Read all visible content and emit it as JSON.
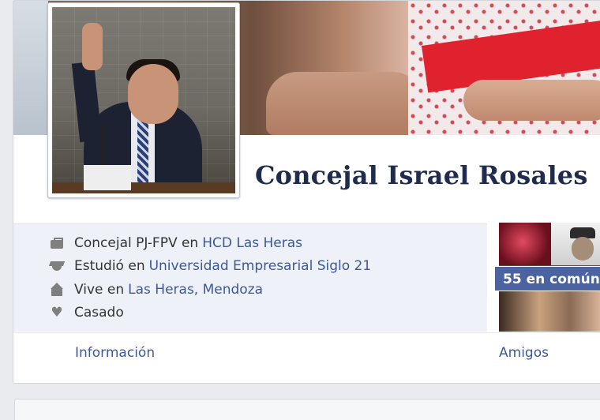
{
  "profile": {
    "name": "Concejal Israel Rosales"
  },
  "about": {
    "work": {
      "prefix": "Concejal PJ-FPV en",
      "link": "HCD Las Heras",
      "icon": "briefcase-icon"
    },
    "education": {
      "prefix": "Estudió en",
      "link": "Universidad Empresarial Siglo 21",
      "icon": "graduation-cap-icon"
    },
    "lives": {
      "prefix": "Vive en",
      "link": "Las Heras, Mendoza",
      "icon": "home-icon"
    },
    "relationship": {
      "text": "Casado",
      "icon": "heart-icon"
    }
  },
  "tabs": {
    "info": "Información",
    "friends": "Amigos"
  },
  "friends": {
    "common_label": "55 en común"
  },
  "colors": {
    "link": "#3b5998",
    "title": "#1f2c4d",
    "badge": "#4b63a1",
    "about_bg": "#eef1f7"
  }
}
